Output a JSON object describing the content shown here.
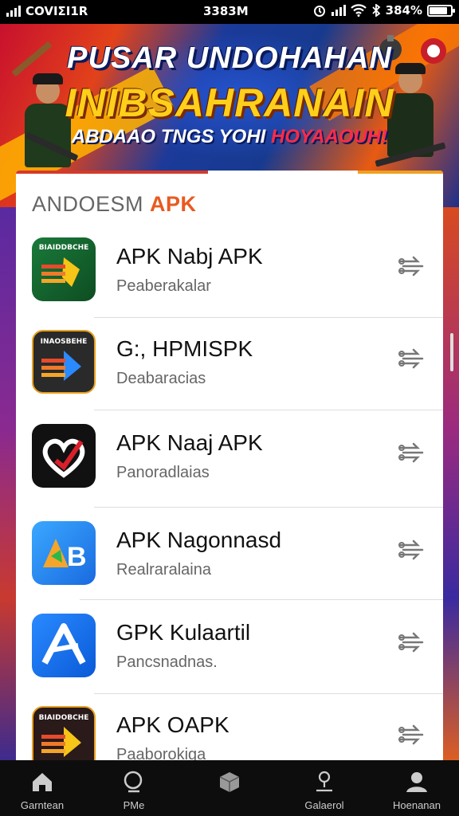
{
  "status_bar": {
    "carrier": "COVIΣI1R",
    "time": "3383M",
    "battery_text": "384%",
    "battery_level": 0.85
  },
  "banner": {
    "title_line1": "PUSAR UNDOHAHAN",
    "title_line2": "INIBSAHRANAIN",
    "subtitle_main": "ABDAAO TNGS YOHI ",
    "subtitle_accent": "HOYAAOUH!"
  },
  "section": {
    "title_main": "ANDOESM ",
    "title_accent": "APK"
  },
  "apps": [
    {
      "title": "APK Nabj APK",
      "subtitle": "Peaberakalar",
      "icon": "green-arrow-app-icon",
      "icon_text": "BIAIDDBCHE"
    },
    {
      "title": "G:, HPMISPK",
      "subtitle": "Deabaracias",
      "icon": "arrow-dark-app-icon",
      "icon_text": "INAOSBEHE"
    },
    {
      "title": "APK Naaj APK",
      "subtitle": "Panoradlaias",
      "icon": "heart-check-app-icon",
      "icon_text": ""
    },
    {
      "title": "APK Nagonnasd",
      "subtitle": "Realraralaina",
      "icon": "ab-blue-app-icon",
      "icon_text": ""
    },
    {
      "title": "GPK Kulaartil",
      "subtitle": "Pancsnadnas.",
      "icon": "a-blue-app-icon",
      "icon_text": ""
    },
    {
      "title": "APK OAPK",
      "subtitle": "Paaborokiga",
      "icon": "arrow-dark-app-icon",
      "icon_text": "BIAIDOBCHE"
    }
  ],
  "nav": [
    {
      "label": "Garntean",
      "icon": "home-icon"
    },
    {
      "label": "PMe",
      "icon": "search-icon"
    },
    {
      "label": "",
      "icon": "box-icon"
    },
    {
      "label": "Galaerol",
      "icon": "location-person-icon"
    },
    {
      "label": "Hoenanan",
      "icon": "profile-icon"
    }
  ]
}
